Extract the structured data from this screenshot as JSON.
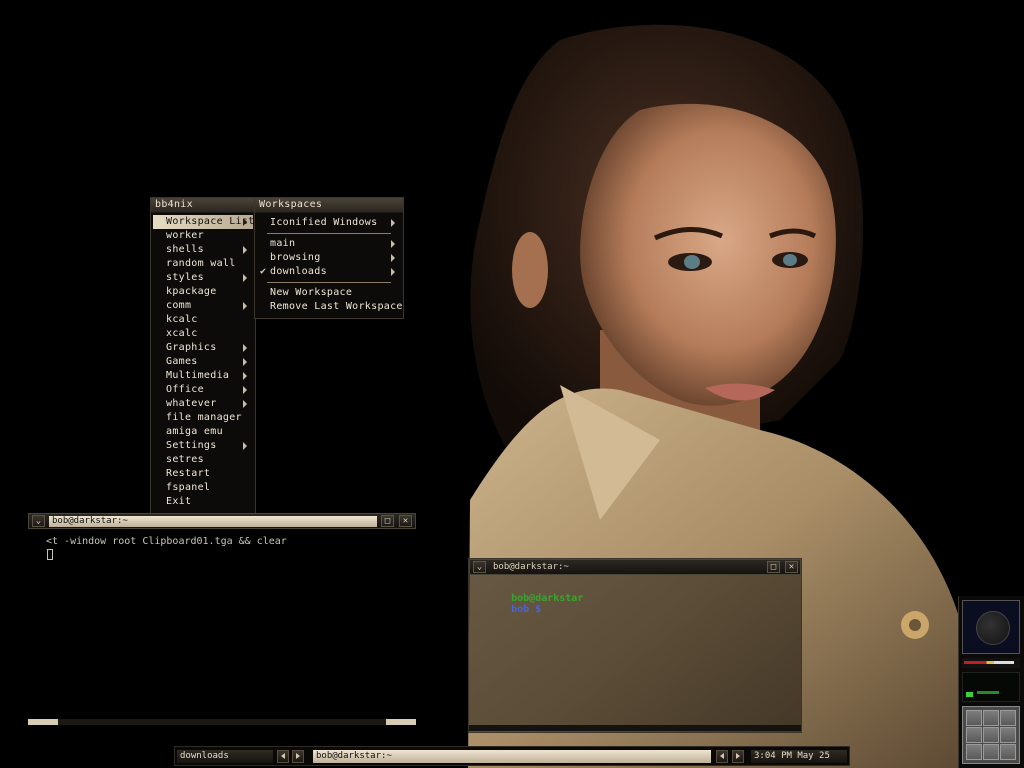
{
  "root_menu": {
    "title": "bb4nix",
    "items": [
      {
        "label": "Workspace List",
        "submenu": true,
        "active": true
      },
      {
        "label": "worker",
        "submenu": false
      },
      {
        "label": "shells",
        "submenu": true
      },
      {
        "label": "random wall",
        "submenu": false
      },
      {
        "label": "styles",
        "submenu": true
      },
      {
        "label": "kpackage",
        "submenu": false
      },
      {
        "label": "comm",
        "submenu": true
      },
      {
        "label": "kcalc",
        "submenu": false
      },
      {
        "label": "xcalc",
        "submenu": false
      },
      {
        "label": "Graphics",
        "submenu": true
      },
      {
        "label": "Games",
        "submenu": true
      },
      {
        "label": "Multimedia",
        "submenu": true
      },
      {
        "label": "Office",
        "submenu": true
      },
      {
        "label": "whatever",
        "submenu": true
      },
      {
        "label": "file manager",
        "submenu": false
      },
      {
        "label": "amiga emu",
        "submenu": false
      },
      {
        "label": "Settings",
        "submenu": true
      },
      {
        "label": "setres",
        "submenu": false
      },
      {
        "label": "Restart",
        "submenu": false
      },
      {
        "label": "fspanel",
        "submenu": false
      },
      {
        "label": "Exit",
        "submenu": false
      }
    ]
  },
  "workspace_menu": {
    "title": "Workspaces",
    "iconified": "Iconified Windows",
    "workspaces": [
      {
        "label": "main",
        "checked": false
      },
      {
        "label": "browsing",
        "checked": false
      },
      {
        "label": "downloads",
        "checked": true
      }
    ],
    "actions": [
      "New Workspace",
      "Remove Last Workspace"
    ]
  },
  "term1": {
    "title": "bob@darkstar:~",
    "line1": "<t -window root Clipboard01.tga && clear"
  },
  "term2": {
    "title": "bob@darkstar:~",
    "prompt_user": "bob@darkstar",
    "prompt_dir": "bob $"
  },
  "taskbar": {
    "workspace": "downloads",
    "window": "bob@darkstar:~",
    "clock": "3:04 PM May 25"
  },
  "icons": {
    "window_menu": "chevron-down-icon",
    "maximize": "maximize-icon",
    "close": "close-icon",
    "checkmark": "checkmark-icon"
  },
  "colors": {
    "menu_bg": "#0c0b09",
    "menu_highlight": "#e8dcc4",
    "prompt_user": "#3aa52e",
    "prompt_dir": "#4b63d8",
    "coat": "#b59a72"
  }
}
